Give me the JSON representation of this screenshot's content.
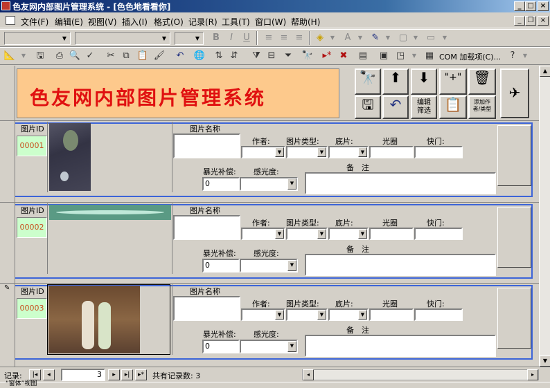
{
  "window": {
    "title": "色友网内部图片管理系统 - [色色地看看你]"
  },
  "menu": {
    "items": [
      "文件(F)",
      "编辑(E)",
      "视图(V)",
      "插入(I)",
      "格式(O)",
      "记录(R)",
      "工具(T)",
      "窗口(W)",
      "帮助(H)"
    ]
  },
  "toolbar": {
    "com_addins": "COM 加载项(C)..."
  },
  "header": {
    "banner": "色友网内部图片管理系统",
    "btn_filter": "编辑\n筛选",
    "btn_add_author": "添加作\n者/类型"
  },
  "fields": {
    "photo_id": "图片ID",
    "photo_name": "图片名称",
    "author": "作者:",
    "photo_type": "图片类型:",
    "negative": "底片:",
    "aperture": "光圈",
    "shutter": "快门:",
    "exposure_comp": "暴光补偿:",
    "iso": "感光度:",
    "notes": "备　注"
  },
  "records": [
    {
      "id": "00001",
      "exposure": "0"
    },
    {
      "id": "00002",
      "exposure": "0"
    },
    {
      "id": "00003",
      "exposure": "0"
    }
  ],
  "navigation": {
    "label": "记录:",
    "current": "3",
    "total_text": "共有记录数: 3"
  },
  "status": {
    "text": "“窗体”视图"
  }
}
